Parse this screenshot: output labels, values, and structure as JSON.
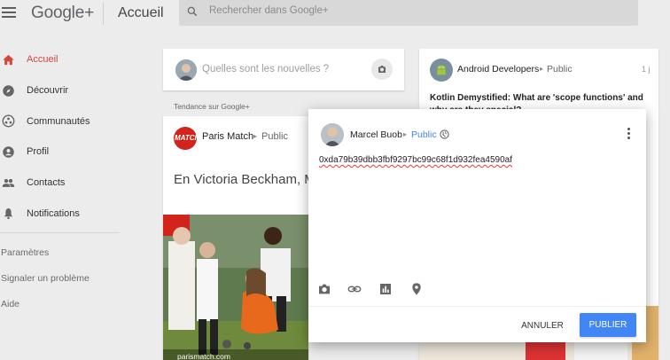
{
  "header": {
    "logo": "Google+",
    "page_title": "Accueil",
    "search_placeholder": "Rechercher dans Google+"
  },
  "sidebar": {
    "items": [
      {
        "label": "Accueil",
        "icon": "home-icon",
        "active": true
      },
      {
        "label": "Découvrir",
        "icon": "compass-icon",
        "active": false
      },
      {
        "label": "Communautés",
        "icon": "communities-icon",
        "active": false
      },
      {
        "label": "Profil",
        "icon": "profile-icon",
        "active": false
      },
      {
        "label": "Contacts",
        "icon": "contacts-icon",
        "active": false
      },
      {
        "label": "Notifications",
        "icon": "bell-icon",
        "active": false
      }
    ],
    "links": [
      "Paramètres",
      "Signaler un problème",
      "Aide"
    ]
  },
  "compose": {
    "placeholder": "Quelles sont les nouvelles ?"
  },
  "trending_label": "Tendance sur Google+",
  "feed_post": {
    "author": "Paris Match",
    "visibility": "Public",
    "title": "En Victoria Beckham, Me souriante loin des manif",
    "logo_text": "MATCH",
    "image_caption": "parismatch.com"
  },
  "right_post": {
    "author": "Android Developers",
    "visibility": "Public",
    "time": "1 j",
    "headline": "Kotlin Demystified: What are 'scope functions' and why are they special?"
  },
  "modal": {
    "author": "Marcel Buob",
    "visibility": "Public",
    "text": "0xda79b39dbb3fbf9297bc99c68f1d932fea4590af",
    "cancel_label": "ANNULER",
    "publish_label": "PUBLIER"
  },
  "colors": {
    "accent_red": "#d34836",
    "brand_blue": "#4285f4"
  }
}
